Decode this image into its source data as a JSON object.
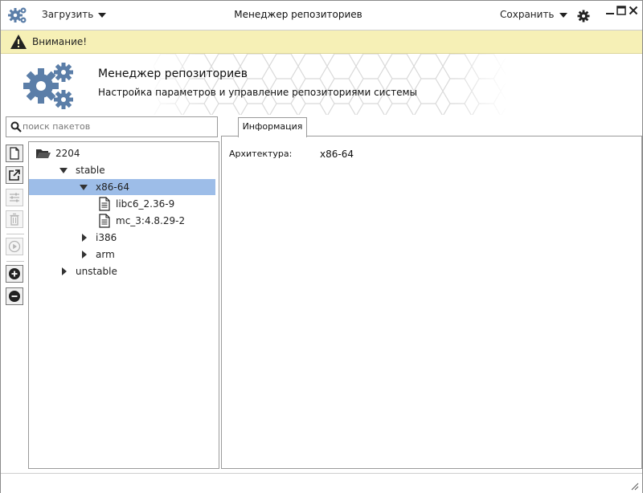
{
  "window": {
    "title": "Менеджер репозиториев",
    "menu_left": "Загрузить",
    "menu_right": "Сохранить"
  },
  "warning": {
    "text": "Внимание!"
  },
  "header": {
    "title": "Менеджер репозиториев",
    "subtitle": "Настройка параметров и управление репозиториями системы"
  },
  "search": {
    "placeholder": "поиск пакетов",
    "value": ""
  },
  "tabs": [
    {
      "label": "Информация",
      "active": true
    }
  ],
  "toolbar": {
    "items": [
      {
        "icon": "new-file-icon",
        "enabled": true
      },
      {
        "icon": "open-external-icon",
        "enabled": true
      },
      {
        "icon": "settings-sliders-icon",
        "enabled": false
      },
      {
        "icon": "trash-icon",
        "enabled": false
      },
      {
        "icon": "play-icon",
        "enabled": false
      },
      {
        "icon": "plus-circle-icon",
        "enabled": true
      },
      {
        "icon": "minus-circle-icon",
        "enabled": true
      }
    ]
  },
  "tree": {
    "root": "2204",
    "stable": "stable",
    "arch_x86": "x86-64",
    "pkg1": "libc6_2.36-9",
    "pkg2": "mc_3:4.8.29-2",
    "arch_i386": "i386",
    "arch_arm": "arm",
    "unstable": "unstable",
    "selected": "x86-64"
  },
  "info": {
    "architecture_label": "Архитектура:",
    "architecture_value": "x86-64"
  },
  "colors": {
    "accent": "#5b7ea8",
    "selection": "#9dbde8",
    "warning_bg": "#f6f0b6"
  }
}
